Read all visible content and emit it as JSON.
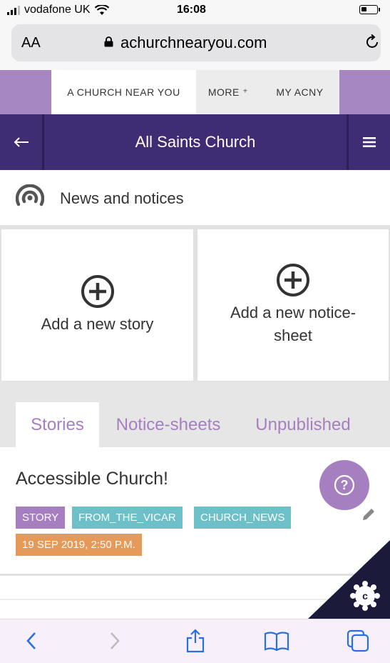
{
  "status_bar": {
    "carrier": "vodafone UK",
    "time": "16:08"
  },
  "browser": {
    "text_size_label": "AA",
    "domain": "achurchnearyou.com",
    "icons": [
      "lock-icon",
      "reload-icon"
    ]
  },
  "top_nav": {
    "items": [
      {
        "label": "A CHURCH NEAR YOU"
      },
      {
        "label": "MORE ⁺"
      },
      {
        "label": "MY ACNY"
      }
    ]
  },
  "church_header": {
    "title": "All Saints Church",
    "icons": [
      "back-arrow-icon",
      "hamburger-menu-icon"
    ]
  },
  "section": {
    "title": "News and notices",
    "icon": "broadcast-icon"
  },
  "add_cards": [
    {
      "label": "Add a new story",
      "icon": "plus-circle-icon"
    },
    {
      "label": "Add a new notice-sheet",
      "icon": "plus-circle-icon"
    }
  ],
  "tabs": [
    {
      "label": "Stories",
      "active": true
    },
    {
      "label": "Notice-sheets",
      "active": false
    },
    {
      "label": "Unpublished",
      "active": false
    }
  ],
  "stories": [
    {
      "title": "Accessible Church!",
      "tags": [
        {
          "label": "STORY",
          "color": "#a67fc0"
        },
        {
          "label": "FROM_THE_VICAR",
          "color": "#6dc0c8"
        },
        {
          "label": "CHURCH_NEWS",
          "color": "#6dc0c8"
        }
      ],
      "date": {
        "label": "19 SEP 2019, 2:50 P.M.",
        "color": "#e69a5a"
      }
    }
  ],
  "help_button": {
    "label": "?",
    "icon": "help-icon"
  },
  "colors": {
    "brand_purple": "#3f2d73",
    "accent_lilac": "#a67fc0",
    "tag_teal": "#6dc0c8",
    "tag_orange": "#e69a5a"
  },
  "toolbar_icons": [
    "back-icon",
    "forward-icon",
    "share-icon",
    "bookmarks-icon",
    "tabs-icon"
  ]
}
